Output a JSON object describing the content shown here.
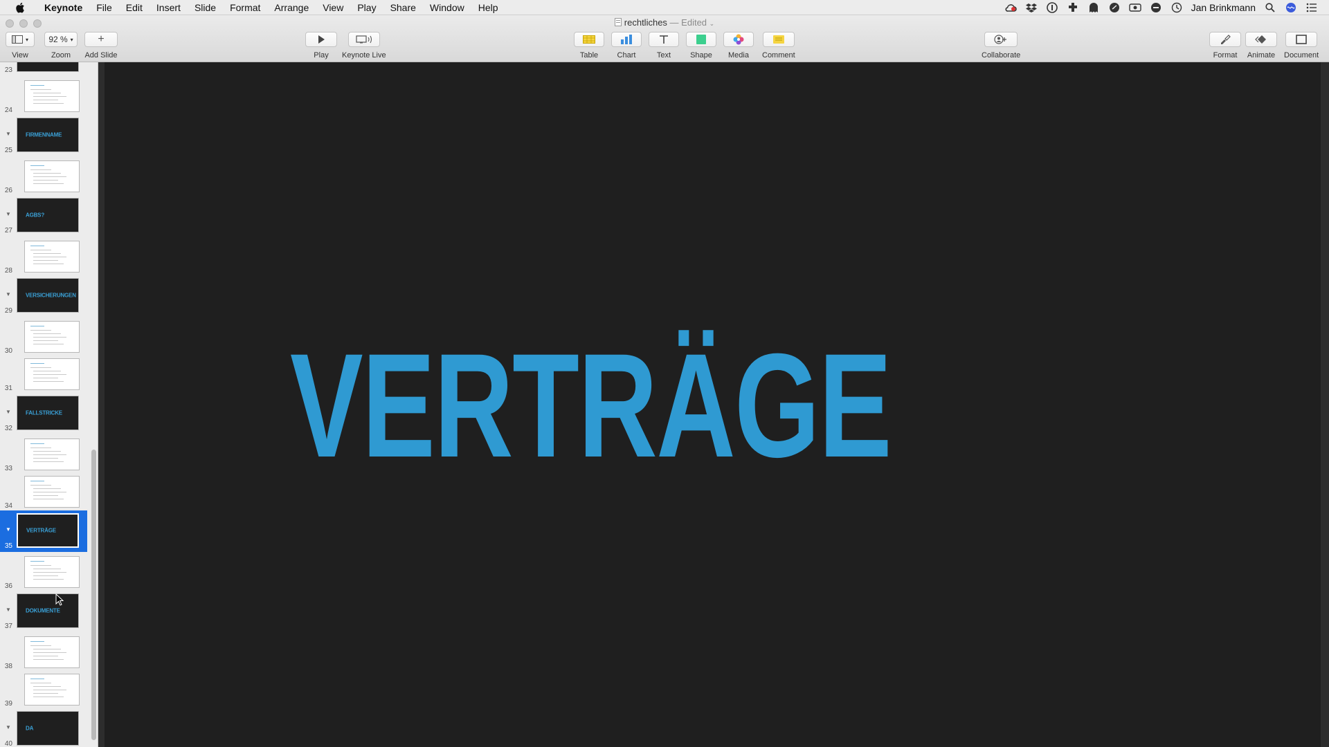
{
  "menubar": {
    "app_name": "Keynote",
    "items": [
      "File",
      "Edit",
      "Insert",
      "Slide",
      "Format",
      "Arrange",
      "View",
      "Play",
      "Share",
      "Window",
      "Help"
    ],
    "user": "Jan Brinkmann"
  },
  "window": {
    "doc_name": "rechtliches",
    "separator": "—",
    "edited_label": "Edited"
  },
  "toolbar": {
    "view_label": "View",
    "zoom_value": "92 %",
    "zoom_label": "Zoom",
    "add_slide_label": "Add Slide",
    "play_label": "Play",
    "keynote_live_label": "Keynote Live",
    "table_label": "Table",
    "chart_label": "Chart",
    "text_label": "Text",
    "shape_label": "Shape",
    "media_label": "Media",
    "comment_label": "Comment",
    "collaborate_label": "Collaborate",
    "format_label": "Format",
    "animate_label": "Animate",
    "document_label": "Document"
  },
  "colors": {
    "accent_blue": "#2f9ad2",
    "selection": "#1b6de0",
    "slide_bg": "#1f1f1f"
  },
  "slides": [
    {
      "num": "23",
      "type": "dark",
      "title": ""
    },
    {
      "num": "24",
      "type": "light"
    },
    {
      "num": "25",
      "type": "dark",
      "title": "FIRMENNAME"
    },
    {
      "num": "26",
      "type": "light"
    },
    {
      "num": "27",
      "type": "dark",
      "title": "AGBS?"
    },
    {
      "num": "28",
      "type": "light"
    },
    {
      "num": "29",
      "type": "dark",
      "title": "VERSICHERUNGEN"
    },
    {
      "num": "30",
      "type": "light"
    },
    {
      "num": "31",
      "type": "light"
    },
    {
      "num": "32",
      "type": "dark",
      "title": "FALLSTRICKE"
    },
    {
      "num": "33",
      "type": "light"
    },
    {
      "num": "34",
      "type": "light"
    },
    {
      "num": "35",
      "type": "dark",
      "title": "VERTRÄGE",
      "selected": true
    },
    {
      "num": "36",
      "type": "light"
    },
    {
      "num": "37",
      "type": "dark",
      "title": "DOKUMENTE"
    },
    {
      "num": "38",
      "type": "light"
    },
    {
      "num": "39",
      "type": "light"
    },
    {
      "num": "40",
      "type": "dark",
      "title": "DA"
    }
  ],
  "current_slide": {
    "title": "VERTRÄGE"
  }
}
